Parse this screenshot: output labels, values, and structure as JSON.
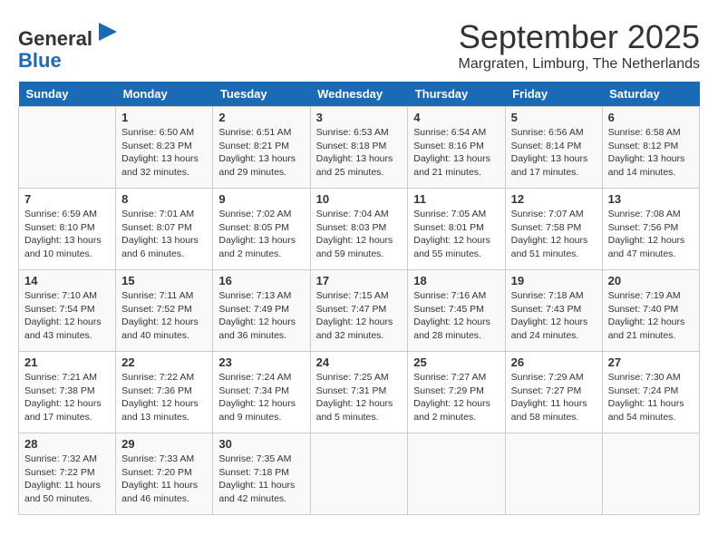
{
  "header": {
    "logo_line1": "General",
    "logo_line2": "Blue",
    "title": "September 2025",
    "location": "Margraten, Limburg, The Netherlands"
  },
  "weekdays": [
    "Sunday",
    "Monday",
    "Tuesday",
    "Wednesday",
    "Thursday",
    "Friday",
    "Saturday"
  ],
  "weeks": [
    [
      {
        "day": "",
        "info": ""
      },
      {
        "day": "1",
        "info": "Sunrise: 6:50 AM\nSunset: 8:23 PM\nDaylight: 13 hours\nand 32 minutes."
      },
      {
        "day": "2",
        "info": "Sunrise: 6:51 AM\nSunset: 8:21 PM\nDaylight: 13 hours\nand 29 minutes."
      },
      {
        "day": "3",
        "info": "Sunrise: 6:53 AM\nSunset: 8:18 PM\nDaylight: 13 hours\nand 25 minutes."
      },
      {
        "day": "4",
        "info": "Sunrise: 6:54 AM\nSunset: 8:16 PM\nDaylight: 13 hours\nand 21 minutes."
      },
      {
        "day": "5",
        "info": "Sunrise: 6:56 AM\nSunset: 8:14 PM\nDaylight: 13 hours\nand 17 minutes."
      },
      {
        "day": "6",
        "info": "Sunrise: 6:58 AM\nSunset: 8:12 PM\nDaylight: 13 hours\nand 14 minutes."
      }
    ],
    [
      {
        "day": "7",
        "info": "Sunrise: 6:59 AM\nSunset: 8:10 PM\nDaylight: 13 hours\nand 10 minutes."
      },
      {
        "day": "8",
        "info": "Sunrise: 7:01 AM\nSunset: 8:07 PM\nDaylight: 13 hours\nand 6 minutes."
      },
      {
        "day": "9",
        "info": "Sunrise: 7:02 AM\nSunset: 8:05 PM\nDaylight: 13 hours\nand 2 minutes."
      },
      {
        "day": "10",
        "info": "Sunrise: 7:04 AM\nSunset: 8:03 PM\nDaylight: 12 hours\nand 59 minutes."
      },
      {
        "day": "11",
        "info": "Sunrise: 7:05 AM\nSunset: 8:01 PM\nDaylight: 12 hours\nand 55 minutes."
      },
      {
        "day": "12",
        "info": "Sunrise: 7:07 AM\nSunset: 7:58 PM\nDaylight: 12 hours\nand 51 minutes."
      },
      {
        "day": "13",
        "info": "Sunrise: 7:08 AM\nSunset: 7:56 PM\nDaylight: 12 hours\nand 47 minutes."
      }
    ],
    [
      {
        "day": "14",
        "info": "Sunrise: 7:10 AM\nSunset: 7:54 PM\nDaylight: 12 hours\nand 43 minutes."
      },
      {
        "day": "15",
        "info": "Sunrise: 7:11 AM\nSunset: 7:52 PM\nDaylight: 12 hours\nand 40 minutes."
      },
      {
        "day": "16",
        "info": "Sunrise: 7:13 AM\nSunset: 7:49 PM\nDaylight: 12 hours\nand 36 minutes."
      },
      {
        "day": "17",
        "info": "Sunrise: 7:15 AM\nSunset: 7:47 PM\nDaylight: 12 hours\nand 32 minutes."
      },
      {
        "day": "18",
        "info": "Sunrise: 7:16 AM\nSunset: 7:45 PM\nDaylight: 12 hours\nand 28 minutes."
      },
      {
        "day": "19",
        "info": "Sunrise: 7:18 AM\nSunset: 7:43 PM\nDaylight: 12 hours\nand 24 minutes."
      },
      {
        "day": "20",
        "info": "Sunrise: 7:19 AM\nSunset: 7:40 PM\nDaylight: 12 hours\nand 21 minutes."
      }
    ],
    [
      {
        "day": "21",
        "info": "Sunrise: 7:21 AM\nSunset: 7:38 PM\nDaylight: 12 hours\nand 17 minutes."
      },
      {
        "day": "22",
        "info": "Sunrise: 7:22 AM\nSunset: 7:36 PM\nDaylight: 12 hours\nand 13 minutes."
      },
      {
        "day": "23",
        "info": "Sunrise: 7:24 AM\nSunset: 7:34 PM\nDaylight: 12 hours\nand 9 minutes."
      },
      {
        "day": "24",
        "info": "Sunrise: 7:25 AM\nSunset: 7:31 PM\nDaylight: 12 hours\nand 5 minutes."
      },
      {
        "day": "25",
        "info": "Sunrise: 7:27 AM\nSunset: 7:29 PM\nDaylight: 12 hours\nand 2 minutes."
      },
      {
        "day": "26",
        "info": "Sunrise: 7:29 AM\nSunset: 7:27 PM\nDaylight: 11 hours\nand 58 minutes."
      },
      {
        "day": "27",
        "info": "Sunrise: 7:30 AM\nSunset: 7:24 PM\nDaylight: 11 hours\nand 54 minutes."
      }
    ],
    [
      {
        "day": "28",
        "info": "Sunrise: 7:32 AM\nSunset: 7:22 PM\nDaylight: 11 hours\nand 50 minutes."
      },
      {
        "day": "29",
        "info": "Sunrise: 7:33 AM\nSunset: 7:20 PM\nDaylight: 11 hours\nand 46 minutes."
      },
      {
        "day": "30",
        "info": "Sunrise: 7:35 AM\nSunset: 7:18 PM\nDaylight: 11 hours\nand 42 minutes."
      },
      {
        "day": "",
        "info": ""
      },
      {
        "day": "",
        "info": ""
      },
      {
        "day": "",
        "info": ""
      },
      {
        "day": "",
        "info": ""
      }
    ]
  ]
}
